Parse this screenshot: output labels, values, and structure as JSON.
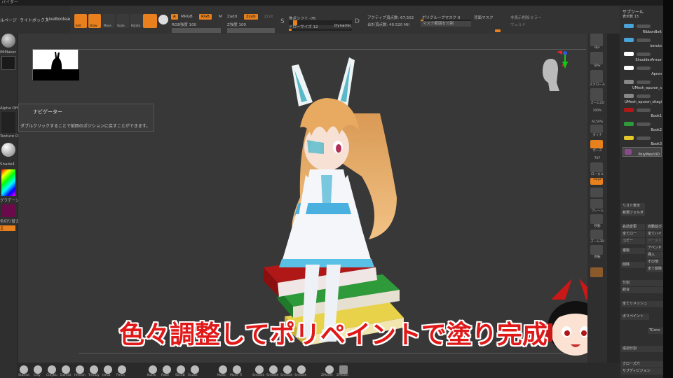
{
  "titlebar": {
    "text": "バイダー"
  },
  "menubar": {
    "items": [
      "ルページ",
      "ライトボックス",
      "LiveBoolean"
    ]
  },
  "shelf": {
    "buttons": [
      "Edit",
      "Draw",
      "Move",
      "Scale",
      "Rotate"
    ],
    "mrgb": "MRGB",
    "rgb": "RGB",
    "m": "M",
    "a_chip": "A",
    "rgb_intensity": "RGB強度 100",
    "zadd": "Zadd",
    "zsub": "Zsub",
    "zcut": "Zcut",
    "z_intensity": "Z強度 100",
    "focal_shift": "焦点シフト -76",
    "draw_size": "ドローサイズ 12",
    "dynamic": "Dynamic",
    "active_points": "アクティブ頂点数: 67,502",
    "total_points": "合計頂点数: 40.520 Mil",
    "polygroup_mask": "ポリグループマスク 0",
    "mask_split": "マスク範囲を分割",
    "back_mask": "背面マスク",
    "unmask": "非表示削除",
    "mirror": "ミラー",
    "persp": "ウェルド",
    "s_label": "S",
    "d_label": "D"
  },
  "left_tray": {
    "brush_label": "IMMaker",
    "alpha_label": "Alpha Off",
    "texture_label": "Texture Off",
    "material_label": "Shade4",
    "gradient_label": "グラデーション",
    "switch_label": "色切り替え",
    "alt_label": "え"
  },
  "tooltip": {
    "title": "ナビゲーター",
    "body": "ダブルクリックすることで前回のポジションに戻すことができます。"
  },
  "right_tools": [
    "Bpr",
    "SPix",
    "スクロール",
    "ズーム2D",
    "100%",
    "AC50%",
    "ダイナ",
    "ポーズ",
    "707",
    "ローカル",
    "Gxyz",
    "グ",
    "フレーム",
    "移動",
    "ズーム3D",
    "回転",
    "PolyF",
    "透明"
  ],
  "subtool_panel": {
    "title": "サブツール",
    "count_label": "表示数 13",
    "items": [
      {
        "name": "RibbonBelt",
        "color": "#4aa3d8"
      },
      {
        "name": "beruto",
        "color": "#4aa3d8"
      },
      {
        "name": "ShoulderArmor",
        "color": "#ffffff"
      },
      {
        "name": "Apron",
        "color": "#ffffff"
      },
      {
        "name": "UMesh_epuron_s",
        "color": "#888888"
      },
      {
        "name": "UMesh_epuron_sitagi",
        "color": "#888888"
      },
      {
        "name": "Book1",
        "color": "#b01818"
      },
      {
        "name": "Book2",
        "color": "#2e9a3a"
      },
      {
        "name": "Book3",
        "color": "#e2c62a"
      },
      {
        "name": "PolyMesh3D",
        "color": "#8a4a8a"
      }
    ],
    "list_all": "リスト表示",
    "new_folder": "新規フォルダ",
    "rename": "名前変更",
    "auto_reorder": "自動並び",
    "all_low": "全てロー",
    "all_high": "全てハイ",
    "copy": "コピー",
    "paste": "ペースト",
    "duplicate": "複製",
    "append": "アペンド",
    "insert": "挿入",
    "delete": "削除",
    "other": "その他",
    "delete_all": "全て削除",
    "split": "分割",
    "merge": "結合",
    "remesh_all": "全てリメッシュ",
    "subdiv": "ポリペイント",
    "tconv": "TConv",
    "bottom_items": [
      "追加分割",
      "クローズ穴",
      "サブディビジョン"
    ]
  },
  "bottom_brushes": [
    "Standa",
    "Clay",
    "ClayBu",
    "DamSt",
    "hPolish",
    "TrimDy",
    "Inflat",
    "Pinch",
    "Noise",
    "Rake",
    "SliceB",
    "Snake",
    "Move",
    "Move Ti",
    "Smooth",
    "Smooth",
    "Smooth",
    "Smooth",
    "ZModel",
    "ZModel"
  ],
  "caption": "色々調整してポリペイントで塗り完成",
  "colors": {
    "accent": "#e7801d",
    "caption": "#e01818",
    "canvas": "#383838"
  }
}
